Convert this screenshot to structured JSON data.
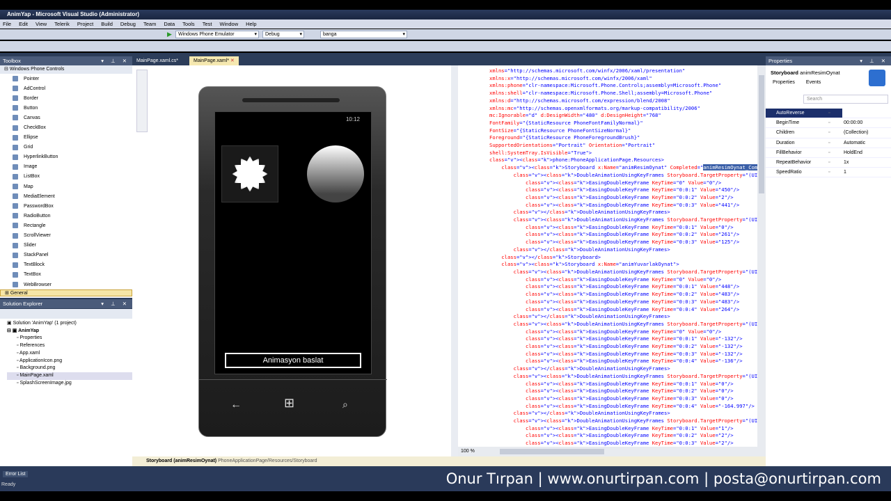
{
  "window": {
    "title": "AnimYap - Microsoft Visual Studio (Administrator)"
  },
  "menu": [
    "File",
    "Edit",
    "View",
    "Telerik",
    "Project",
    "Build",
    "Debug",
    "Team",
    "Data",
    "Tools",
    "Test",
    "Window",
    "Help"
  ],
  "toolbar": {
    "target": "Windows Phone Emulator",
    "config": "Debug",
    "find": "banga"
  },
  "toolbox": {
    "title": "Toolbox",
    "group": "Windows Phone Controls",
    "items": [
      "Pointer",
      "AdControl",
      "Border",
      "Button",
      "Canvas",
      "CheckBox",
      "Ellipse",
      "Grid",
      "HyperlinkButton",
      "Image",
      "ListBox",
      "Map",
      "MediaElement",
      "PasswordBox",
      "RadioButton",
      "Rectangle",
      "ScrollViewer",
      "Slider",
      "StackPanel",
      "TextBlock",
      "TextBox",
      "WebBrowser"
    ],
    "general": "General"
  },
  "solution_explorer": {
    "title": "Solution Explorer",
    "solution": "Solution 'AnimYap' (1 project)",
    "project": "AnimYap",
    "items": [
      "Properties",
      "References",
      "App.xaml",
      "ApplicationIcon.png",
      "Background.png",
      "MainPage.xaml",
      "SplashScreenImage.jpg"
    ]
  },
  "tabs": [
    {
      "label": "MainPage.xaml.cs*"
    },
    {
      "label": "MainPage.xaml*"
    }
  ],
  "phone": {
    "time": "10:12",
    "button": "Animasyon baslat"
  },
  "code": [
    "xmlns=\"http://schemas.microsoft.com/winfx/2006/xaml/presentation\"",
    "xmlns:x=\"http://schemas.microsoft.com/winfx/2006/xaml\"",
    "xmlns:phone=\"clr-namespace:Microsoft.Phone.Controls;assembly=Microsoft.Phone\"",
    "xmlns:shell=\"clr-namespace:Microsoft.Phone.Shell;assembly=Microsoft.Phone\"",
    "xmlns:d=\"http://schemas.microsoft.com/expression/blend/2008\"",
    "xmlns:mc=\"http://schemas.openxmlformats.org/markup-compatibility/2006\"",
    "mc:Ignorable=\"d\" d:DesignWidth=\"480\" d:DesignHeight=\"768\"",
    "FontFamily=\"{StaticResource PhoneFontFamilyNormal}\"",
    "FontSize=\"{StaticResource PhoneFontSizeNormal}\"",
    "Foreground=\"{StaticResource PhoneForegroundBrush}\"",
    "SupportedOrientations=\"Portrait\" Orientation=\"Portrait\"",
    "shell:SystemTray.IsVisible=\"True\">",
    "<phone:PhoneApplicationPage.Resources>",
    "    <Storyboard x:Name=\"animResimOynat\" Completed=\"animResimOynat_Completed\">",
    "        <DoubleAnimationUsingKeyFrames Storyboard.TargetProperty=\"(UIElement.Rende",
    "            <EasingDoubleKeyFrame KeyTime=\"0\" Value=\"0\"/>",
    "            <EasingDoubleKeyFrame KeyTime=\"0:0:1\" Value=\"450\"/>",
    "            <EasingDoubleKeyFrame KeyTime=\"0:0:2\" Value=\"2\"/>",
    "            <EasingDoubleKeyFrame KeyTime=\"0:0:3\" Value=\"441\"/>",
    "        </DoubleAnimationUsingKeyFrames>",
    "        <DoubleAnimationUsingKeyFrames Storyboard.TargetProperty=\"(UIElement.Rende",
    "            <EasingDoubleKeyFrame KeyTime=\"0:0:1\" Value=\"0\"/>",
    "            <EasingDoubleKeyFrame KeyTime=\"0:0:2\" Value=\"261\"/>",
    "            <EasingDoubleKeyFrame KeyTime=\"0:0:3\" Value=\"125\"/>",
    "        </DoubleAnimationUsingKeyFrames>",
    "    </Storyboard>",
    "    <Storyboard x:Name=\"animYuvarlakOynat\">",
    "        <DoubleAnimationUsingKeyFrames Storyboard.TargetProperty=\"(UIElement.Rende",
    "            <EasingDoubleKeyFrame KeyTime=\"0\" Value=\"0\"/>",
    "            <EasingDoubleKeyFrame KeyTime=\"0:0:1\" Value=\"448\"/>",
    "            <EasingDoubleKeyFrame KeyTime=\"0:0:2\" Value=\"483\"/>",
    "            <EasingDoubleKeyFrame KeyTime=\"0:0:3\" Value=\"483\"/>",
    "            <EasingDoubleKeyFrame KeyTime=\"0:0:4\" Value=\"264\"/>",
    "        </DoubleAnimationUsingKeyFrames>",
    "        <DoubleAnimationUsingKeyFrames Storyboard.TargetProperty=\"(UIElement.Rende",
    "            <EasingDoubleKeyFrame KeyTime=\"0\" Value=\"0\"/>",
    "            <EasingDoubleKeyFrame KeyTime=\"0:0:1\" Value=\"-132\"/>",
    "            <EasingDoubleKeyFrame KeyTime=\"0:0:2\" Value=\"-132\"/>",
    "            <EasingDoubleKeyFrame KeyTime=\"0:0:3\" Value=\"-132\"/>",
    "            <EasingDoubleKeyFrame KeyTime=\"0:0:4\" Value=\"-136\"/>",
    "        </DoubleAnimationUsingKeyFrames>",
    "        <DoubleAnimationUsingKeyFrames Storyboard.TargetProperty=\"(UIElement.Rende",
    "            <EasingDoubleKeyFrame KeyTime=\"0:0:1\" Value=\"0\"/>",
    "            <EasingDoubleKeyFrame KeyTime=\"0:0:2\" Value=\"0\"/>",
    "            <EasingDoubleKeyFrame KeyTime=\"0:0:3\" Value=\"0\"/>",
    "            <EasingDoubleKeyFrame KeyTime=\"0:0:4\" Value=\"-164.997\"/>",
    "        </DoubleAnimationUsingKeyFrames>",
    "        <DoubleAnimationUsingKeyFrames Storyboard.TargetProperty=\"(UIElement.Rende",
    "            <EasingDoubleKeyFrame KeyTime=\"0:0:1\" Value=\"1\"/>",
    "            <EasingDoubleKeyFrame KeyTime=\"0:0:2\" Value=\"2\"/>",
    "            <EasingDoubleKeyFrame KeyTime=\"0:0:3\" Value=\"2\"/>"
  ],
  "selected_text": "animResimOynat_Completed",
  "zoom": "100 %",
  "properties": {
    "title": "Properties",
    "type": "Storyboard",
    "name": "animResimOynat",
    "tab_properties": "Properties",
    "tab_events": "Events",
    "search_placeholder": "Search",
    "rows": [
      {
        "name": "AutoReverse",
        "value": ""
      },
      {
        "name": "BeginTime",
        "value": "00:00:00"
      },
      {
        "name": "Children",
        "value": "(Collection)"
      },
      {
        "name": "Duration",
        "value": "Automatic"
      },
      {
        "name": "FillBehavior",
        "value": "HoldEnd"
      },
      {
        "name": "RepeatBehavior",
        "value": "1x"
      },
      {
        "name": "SpeedRatio",
        "value": "1"
      }
    ]
  },
  "pathbar": {
    "element": "Storyboard (animResimOynat)",
    "path": "PhoneApplicationPage/Resources/Storyboard"
  },
  "status": {
    "error_list": "Error List",
    "ready": "Ready"
  },
  "watermark": "Onur Tırpan | www.onurtirpan.com | posta@onurtirpan.com"
}
